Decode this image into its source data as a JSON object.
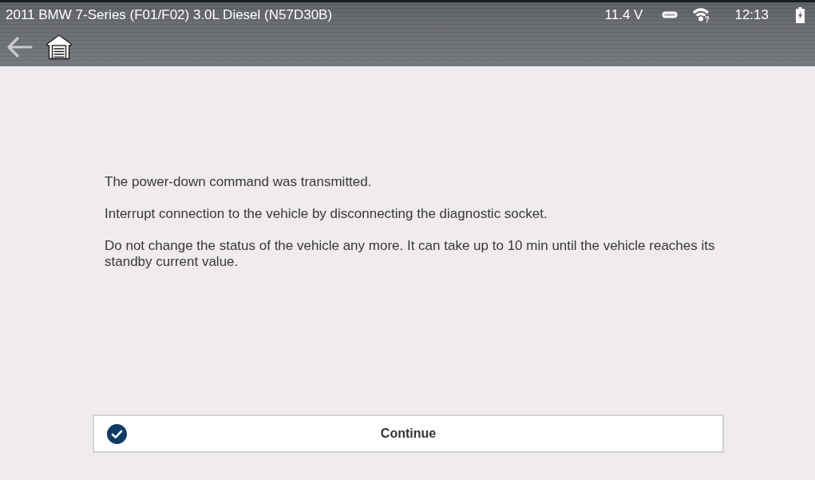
{
  "status_bar": {
    "vehicle": "2011 BMW 7-Series (F01/F02) 3.0L Diesel (N57D30B)",
    "voltage": "11.4 V",
    "time": "12:13"
  },
  "message": {
    "paragraphs": [
      "The power-down command was transmitted.",
      "Interrupt connection to the vehicle by disconnecting the diagnostic socket.",
      "Do not change the status of the vehicle any more. It can take up to 10 min until the vehicle reaches its standby current value."
    ]
  },
  "continue_button": {
    "label": "Continue"
  }
}
